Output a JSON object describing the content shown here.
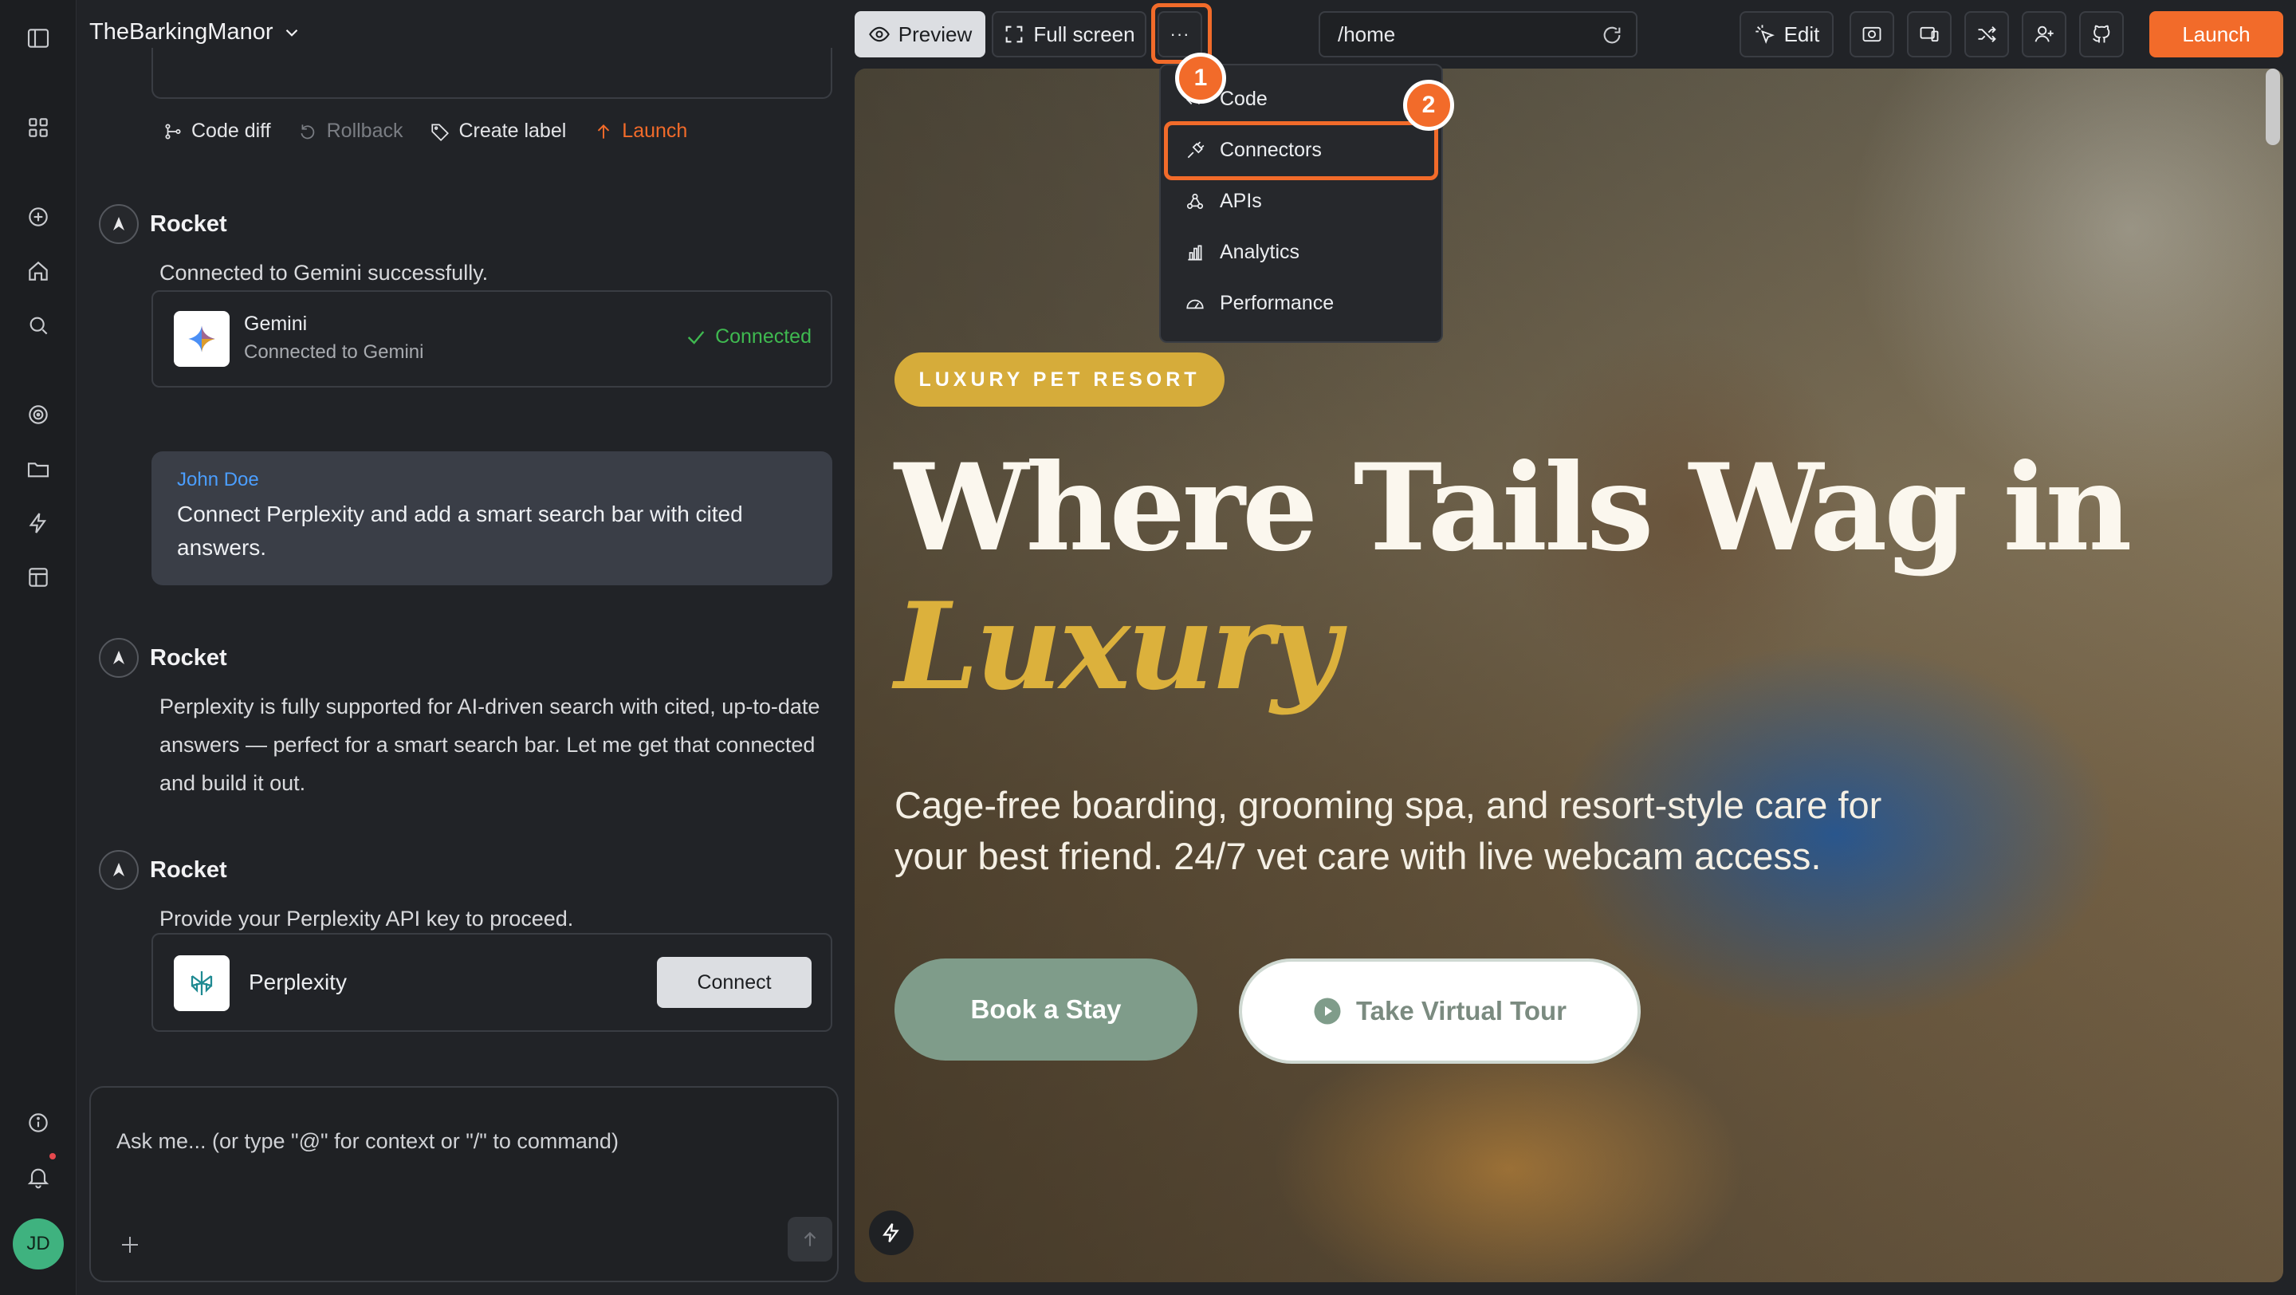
{
  "project": {
    "name": "TheBarkingManor"
  },
  "rail": {
    "avatar_initials": "JD"
  },
  "actions": {
    "code_diff": "Code diff",
    "rollback": "Rollback",
    "create_label": "Create label",
    "launch": "Launch"
  },
  "messages": [
    {
      "author": "Rocket",
      "text": "Connected to Gemini successfully."
    },
    {
      "author": "Rocket",
      "text": "Perplexity is fully supported for AI-driven search with cited, up-to-date answers — perfect for a smart search bar. Let me get that connected and build it out."
    },
    {
      "author": "Rocket",
      "text": "Provide your Perplexity API key to proceed."
    }
  ],
  "gemini_card": {
    "name": "Gemini",
    "subtitle": "Connected to Gemini",
    "status": "Connected",
    "status_color": "#3fb950"
  },
  "user_message": {
    "name": "John Doe",
    "text": "Connect Perplexity and add a smart search bar with cited answers."
  },
  "perplexity_card": {
    "name": "Perplexity",
    "button": "Connect"
  },
  "composer": {
    "placeholder": "Ask me... (or type \"@\" for context or \"/\" to command)"
  },
  "toolbar": {
    "preview": "Preview",
    "fullscreen": "Full screen",
    "more": "···",
    "url": "/home",
    "edit": "Edit",
    "launch": "Launch",
    "accent_color": "#f26b2a"
  },
  "menu": {
    "items": [
      "Code",
      "Connectors",
      "APIs",
      "Analytics",
      "Performance"
    ]
  },
  "annotations": {
    "step1": "1",
    "step2": "2"
  },
  "hero": {
    "badge": "LUXURY PET RESORT",
    "title_line1": "Where Tails Wag in",
    "title_line2": "Luxury",
    "subtitle": "Cage-free boarding, grooming spa, and resort-style care for your best friend. 24/7 vet care with live webcam access.",
    "cta_primary": "Book a Stay",
    "cta_secondary": "Take Virtual Tour",
    "accent_gold": "#d6ac3a",
    "sage": "#7f9c8a"
  }
}
